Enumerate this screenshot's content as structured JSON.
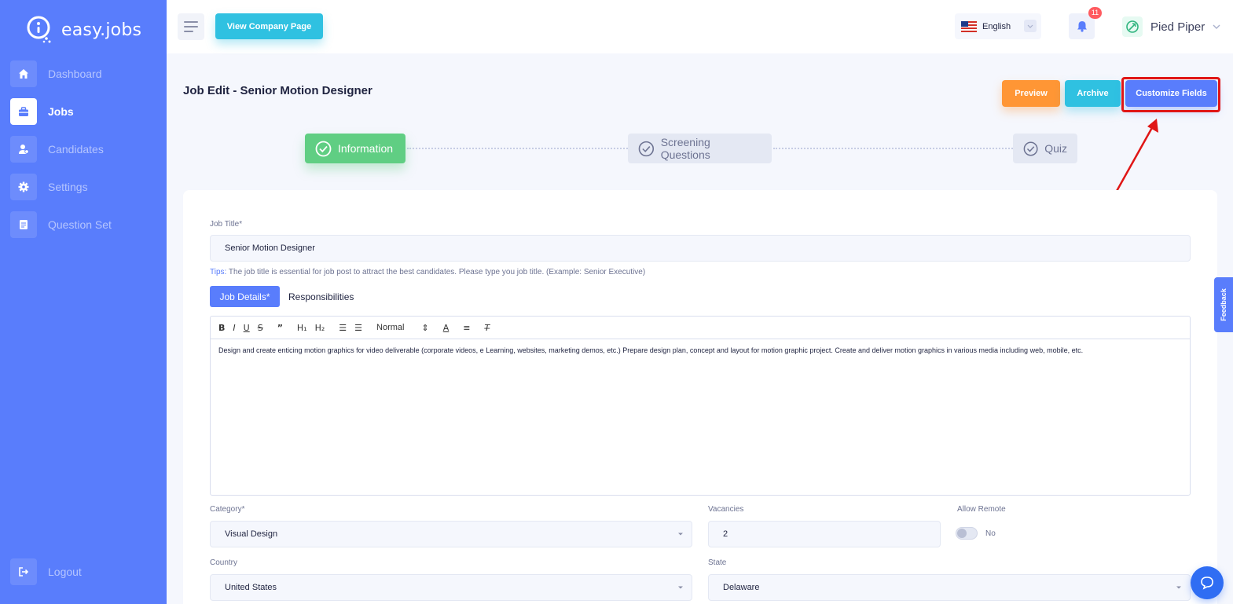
{
  "brand": {
    "name": "easy.jobs"
  },
  "sidebar": {
    "items": [
      {
        "label": "Dashboard",
        "icon": "home-icon"
      },
      {
        "label": "Jobs",
        "icon": "briefcase-icon"
      },
      {
        "label": "Candidates",
        "icon": "user-icon"
      },
      {
        "label": "Settings",
        "icon": "gear-icon"
      },
      {
        "label": "Question Set",
        "icon": "document-icon"
      }
    ],
    "logout": {
      "label": "Logout",
      "icon": "logout-icon"
    }
  },
  "header": {
    "view_company_label": "View Company Page",
    "language": "English",
    "notification_count": "11",
    "company_name": "Pied Piper"
  },
  "page": {
    "title": "Job Edit - Senior Motion Designer",
    "actions": {
      "preview": "Preview",
      "archive": "Archive",
      "customize": "Customize Fields"
    }
  },
  "steps": [
    {
      "label": "Information"
    },
    {
      "label": "Screening Questions"
    },
    {
      "label": "Quiz"
    }
  ],
  "form": {
    "job_title_label": "Job Title*",
    "job_title_value": "Senior Motion Designer",
    "tips_key": "Tips:",
    "tips_text": " The job title is essential for job post to attract the best candidates. Please type you job title. (Example: Senior Executive)",
    "tabs": {
      "details": "Job Details*",
      "responsibilities": "Responsibilities"
    },
    "editor": {
      "heading_select": "Normal",
      "content": "Design and create enticing motion graphics for video deliverable (corporate videos, e Learning, websites, marketing demos, etc.) Prepare design plan, concept and layout for motion graphic project. Create and deliver motion graphics in various media including web, mobile, etc."
    },
    "category_label": "Category*",
    "category_value": "Visual Design",
    "vacancies_label": "Vacancies",
    "vacancies_value": "2",
    "remote_label": "Allow Remote",
    "remote_value": "No",
    "country_label": "Country",
    "country_value": "United States",
    "state_label": "State",
    "state_value": "Delaware"
  },
  "feedback_label": "Feedback",
  "colors": {
    "primary": "#597dfc",
    "success": "#60ce83",
    "warning": "#ff9635",
    "info": "#2fc1e1",
    "highlight": "#e01616"
  }
}
